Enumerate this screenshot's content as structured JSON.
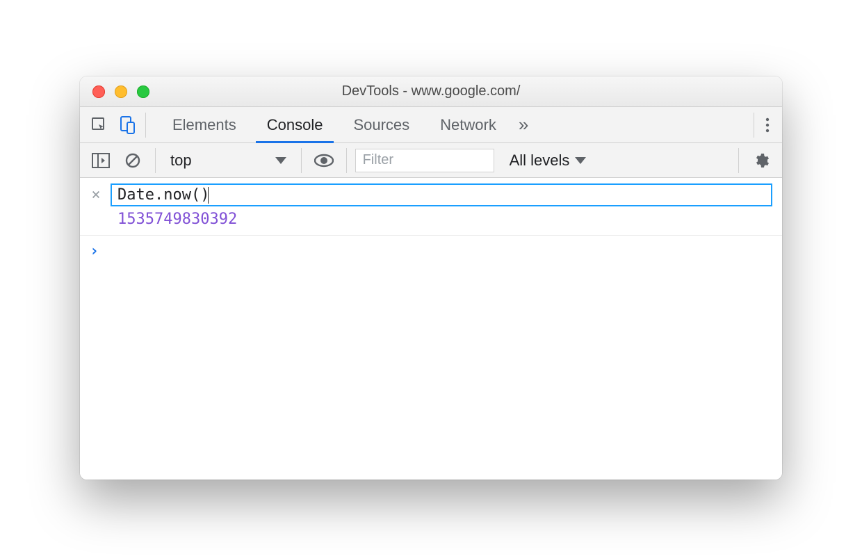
{
  "window": {
    "title": "DevTools - www.google.com/"
  },
  "tabs": {
    "elements": "Elements",
    "console": "Console",
    "sources": "Sources",
    "network": "Network"
  },
  "filterbar": {
    "context": "top",
    "filter_placeholder": "Filter",
    "levels": "All levels"
  },
  "console": {
    "live_expression": "Date.now()",
    "live_result": "1535749830392",
    "clear_live_title": "×",
    "prompt": "›"
  },
  "colors": {
    "accent": "#1a73e8",
    "highlight_border": "#1a9fff",
    "result_number": "#8151d6"
  }
}
